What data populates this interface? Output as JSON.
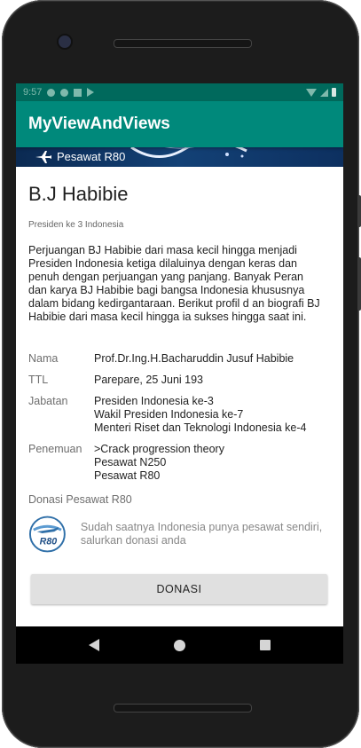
{
  "status_bar": {
    "time": "9:57"
  },
  "app_bar": {
    "title": "MyViewAndViews"
  },
  "banner": {
    "label": "Pesawat R80",
    "icon": "airplane-icon"
  },
  "profile": {
    "name": "B.J Habibie",
    "subtitle": "Presiden ke 3 Indonesia",
    "description": "Perjuangan BJ Habibie dari masa kecil hingga menjadi Presiden Indonesia ketiga dilaluinya dengan keras dan penuh dengan perjuangan yang panjang. Banyak Peran dan karya BJ Habibie bagi bangsa Indonesia khususnya dalam bidang kedirgantaraan. Berikut profil d an biografi BJ Habibie dari masa kecil hingga ia sukses hingga saat ini."
  },
  "info": [
    {
      "label": "Nama",
      "value": "Prof.Dr.Ing.H.Bacharuddin Jusuf Habibie"
    },
    {
      "label": "TTL",
      "value": "Parepare, 25 Juni 193"
    },
    {
      "label": "Jabatan",
      "value": "Presiden Indonesia ke-3\n Wakil Presiden Indonesia ke-7\n Menteri Riset dan Teknologi Indonesia ke-4"
    },
    {
      "label": "Penemuan",
      "value": ">Crack progression theory\n Pesawat N250\n Pesawat R80"
    }
  ],
  "donasi": {
    "title": "Donasi Pesawat R80",
    "logo_text": "R80",
    "text": "Sudah saatnya Indonesia punya pesawat sendiri, salurkan donasi anda",
    "button_label": "DONASI"
  },
  "colors": {
    "primary": "#00897b",
    "primary_dark": "#00695c"
  }
}
